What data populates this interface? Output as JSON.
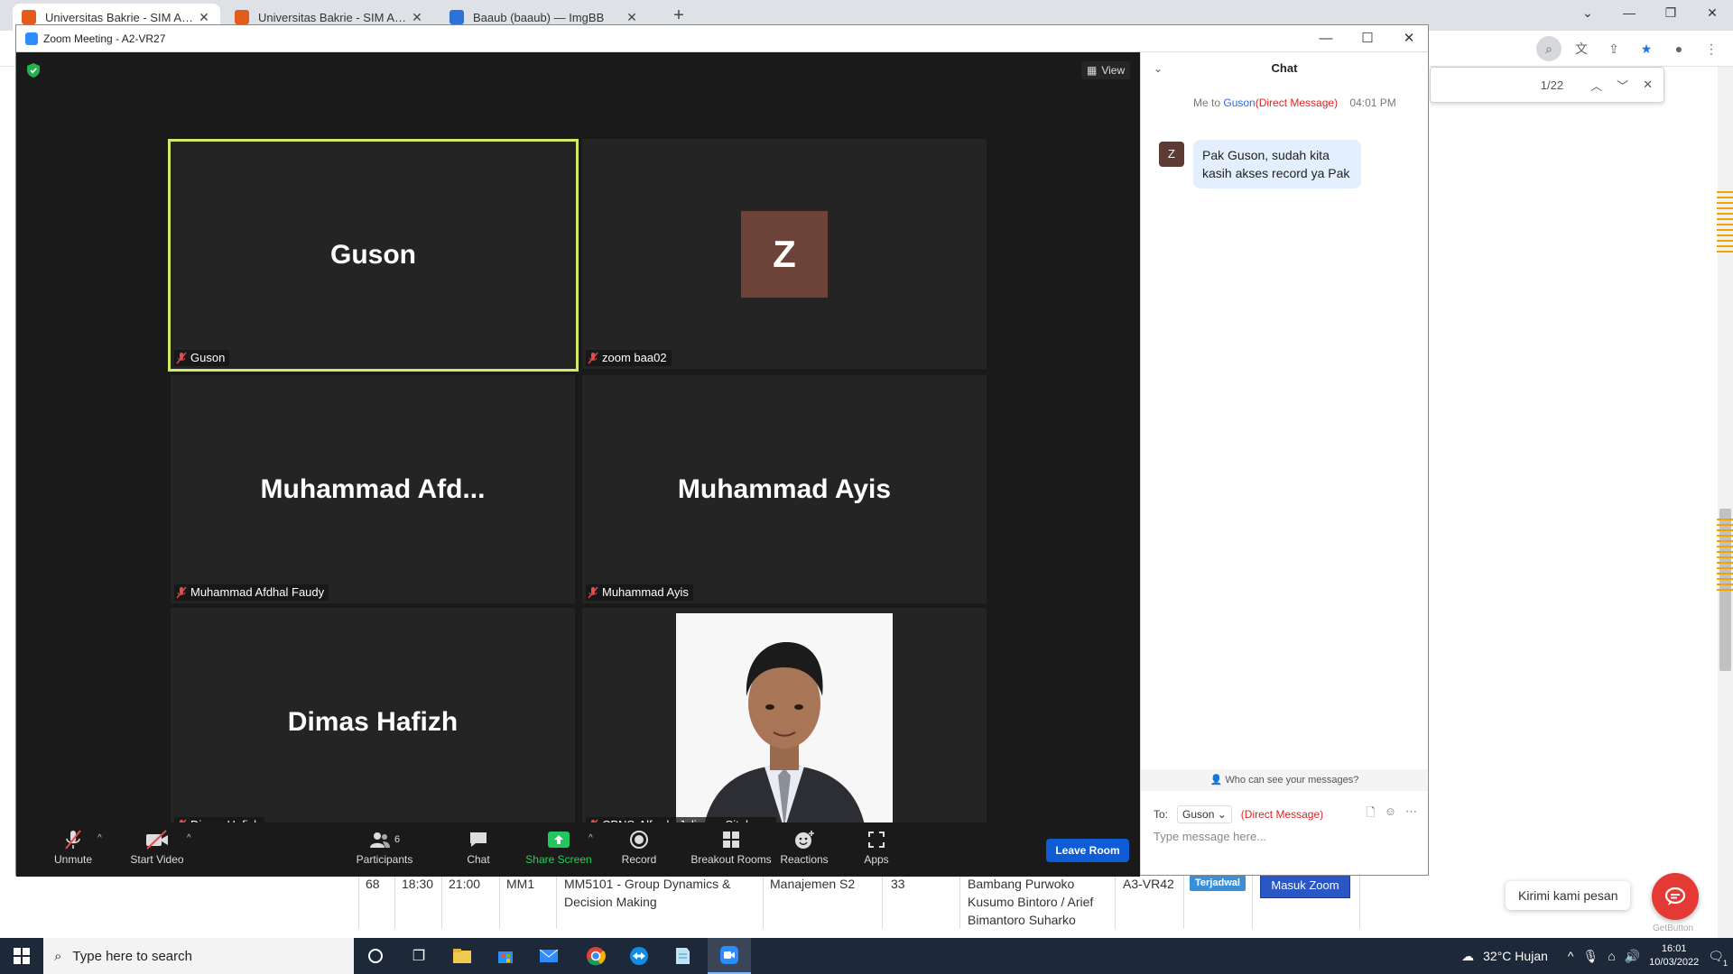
{
  "browser": {
    "tabs": [
      {
        "title": "Universitas Bakrie - SIM Akademik",
        "favicon": "bakrie-icon"
      },
      {
        "title": "Universitas Bakrie - SIM Akademik",
        "favicon": "bakrie-icon"
      },
      {
        "title": "Baaub (baaub) — ImgBB",
        "favicon": "imgbb-icon"
      }
    ],
    "find_count": "1/22"
  },
  "zoom": {
    "window_title": "Zoom Meeting - A2-VR27",
    "view_label": "View",
    "tiles": [
      {
        "big_name": "Guson",
        "label": "Guson",
        "speaking": true
      },
      {
        "avatar_letter": "Z",
        "label": "zoom baa02"
      },
      {
        "big_name": "Muhammad  Afd...",
        "label": "Muhammad Afdhal Faudy"
      },
      {
        "big_name": "Muhammad Ayis",
        "label": "Muhammad Ayis"
      },
      {
        "big_name": "Dimas Hafizh",
        "label": "Dimas Hafizh"
      },
      {
        "label": "CPNS-Alfredo Juliansa Sitohang",
        "has_photo": true
      }
    ],
    "toolbar": {
      "unmute": "Unmute",
      "start_video": "Start Video",
      "participants": "Participants",
      "participants_count": "6",
      "chat": "Chat",
      "share_screen": "Share Screen",
      "record": "Record",
      "breakout_rooms": "Breakout Rooms",
      "reactions": "Reactions",
      "apps": "Apps",
      "leave_room": "Leave Room"
    },
    "chat": {
      "title": "Chat",
      "meta_prefix": "Me to",
      "meta_target": "Guson",
      "meta_dm": "(Direct Message)",
      "meta_time": "04:01 PM",
      "avatar_letter": "Z",
      "message": "Pak Guson, sudah kita kasih akses record ya Pak",
      "who_can_see": "Who can see your messages?",
      "to_label": "To:",
      "to_value": "Guson",
      "to_dm": "(Direct Message)",
      "placeholder": "Type message here..."
    }
  },
  "page": {
    "row": {
      "no": "68",
      "start": "18:30",
      "end": "21:00",
      "code": "MM1",
      "course": "MM5101 - Group Dynamics & Decision Making",
      "program": "Manajemen S2",
      "count": "33",
      "lecturer": "Bambang Purwoko Kusumo Bintoro / Arief Bimantoro Suharko",
      "room": "A3-VR42",
      "status": "Terjadwal",
      "button": "Masuk Zoom"
    },
    "kirimi": "Kirimi kami pesan",
    "getbutton": "GetButton"
  },
  "taskbar": {
    "search_placeholder": "Type here to search",
    "weather": "32°C  Hujan",
    "time": "16:01",
    "date": "10/03/2022",
    "notifications": "1"
  },
  "colors": {
    "speaking_border": "#d6e86a",
    "leave_button": "#0e5dd6",
    "share_green": "#22d35a",
    "dm_red": "#d22222"
  }
}
